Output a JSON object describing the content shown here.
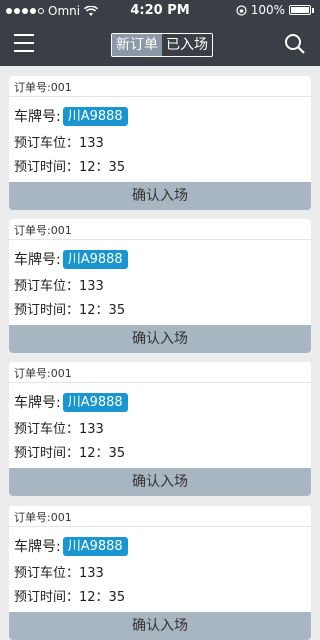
{
  "status": {
    "carrier": "Omni",
    "time": "4:20 PM",
    "battery": "100%"
  },
  "nav": {
    "tab_new": "新订单",
    "tab_entered": "已入场"
  },
  "orders": [
    {
      "order_label": "订单号:001",
      "plate_label": "车牌号:",
      "plate": "川A9888",
      "space_label": "预订车位：133",
      "time_label": "预订时间：12：35",
      "confirm_label": "确认入场"
    },
    {
      "order_label": "订单号:001",
      "plate_label": "车牌号:",
      "plate": "川A9888",
      "space_label": "预订车位：133",
      "time_label": "预订时间：12：35",
      "confirm_label": "确认入场"
    },
    {
      "order_label": "订单号:001",
      "plate_label": "车牌号:",
      "plate": "川A9888",
      "space_label": "预订车位：133",
      "time_label": "预订时间：12：35",
      "confirm_label": "确认入场"
    },
    {
      "order_label": "订单号:001",
      "plate_label": "车牌号:",
      "plate": "川A9888",
      "space_label": "预订车位：133",
      "time_label": "预订时间：12：35",
      "confirm_label": "确认入场"
    }
  ],
  "colors": {
    "nav_bg": "#3a3f45",
    "plate_bg": "#1996cf",
    "confirm_bg": "#a8b6c1",
    "active_tab_bg": "#8a99a5"
  }
}
